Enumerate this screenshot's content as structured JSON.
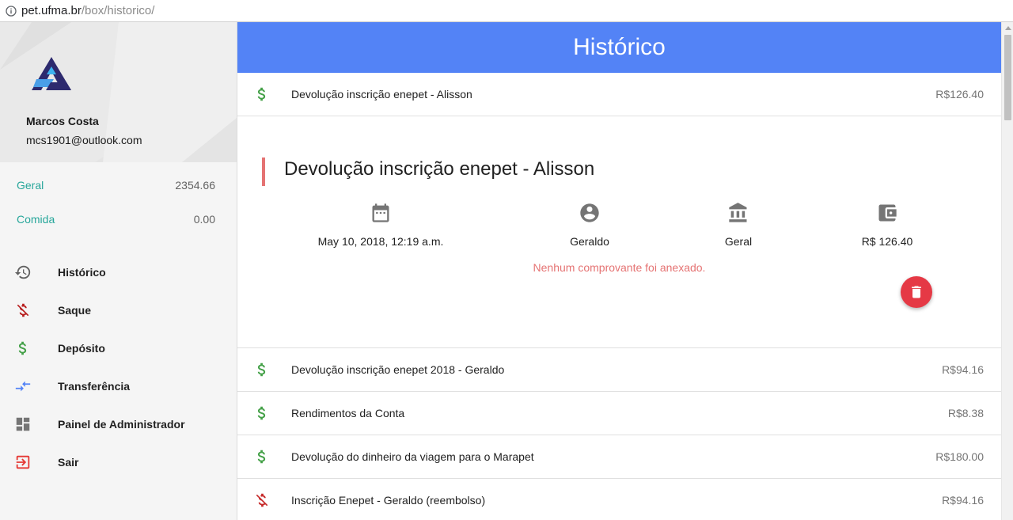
{
  "browser": {
    "url_host": "pet.ufma.br",
    "url_path": "/box/historico/"
  },
  "sidebar": {
    "user_name": "Marcos Costa",
    "user_email": "mcs1901@outlook.com",
    "balances": [
      {
        "label": "Geral",
        "value": "2354.66"
      },
      {
        "label": "Comida",
        "value": "0.00"
      }
    ],
    "nav": [
      {
        "label": "Histórico",
        "icon": "history-icon"
      },
      {
        "label": "Saque",
        "icon": "money-off-icon"
      },
      {
        "label": "Depósito",
        "icon": "dollar-icon"
      },
      {
        "label": "Transferência",
        "icon": "transfer-icon"
      },
      {
        "label": "Painel de Administrador",
        "icon": "dashboard-icon"
      },
      {
        "label": "Sair",
        "icon": "exit-icon"
      }
    ]
  },
  "main": {
    "title": "Histórico",
    "first_row": {
      "description": "Devolução inscrição enepet - Alisson",
      "amount": "R$126.40",
      "type": "deposit"
    },
    "detail": {
      "title": "Devolução inscrição enepet - Alisson",
      "date": "May 10, 2018, 12:19 a.m.",
      "user": "Geraldo",
      "account": "Geral",
      "amount": "R$ 126.40",
      "note": "Nenhum comprovante foi anexado."
    },
    "rows": [
      {
        "description": "Devolução inscrição enepet 2018 - Geraldo",
        "amount": "R$94.16",
        "type": "deposit"
      },
      {
        "description": "Rendimentos da Conta",
        "amount": "R$8.38",
        "type": "deposit"
      },
      {
        "description": "Devolução do dinheiro da viagem para o Marapet",
        "amount": "R$180.00",
        "type": "deposit"
      },
      {
        "description": "Inscrição Enepet - Geraldo (reembolso)",
        "amount": "R$94.16",
        "type": "withdrawal"
      }
    ]
  },
  "colors": {
    "header": "#5383f6",
    "teal": "#26a69a",
    "deposit": "#43a047",
    "withdrawal": "#c62828",
    "note": "#e57373",
    "delete": "#e53945"
  }
}
